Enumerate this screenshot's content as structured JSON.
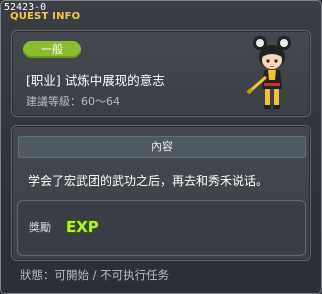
{
  "window": {
    "quest_id": "52423-0",
    "title": "QUEST INFO"
  },
  "quest": {
    "category": "一般",
    "name": "[职业] 试炼中展现的意志",
    "level_range": "建議等級：60～64",
    "npc_portrait": "martial-arts-girl-portrait"
  },
  "content": {
    "header": "內容",
    "description": "学会了宏武团的武功之后，再去和秀禾说话。"
  },
  "reward": {
    "label": "獎勵",
    "items": [
      "EXP"
    ]
  },
  "status": {
    "text": "狀態：可開始 / 不可执行任务"
  },
  "colors": {
    "title": "#f5c94a",
    "badge": "#8bbc2e",
    "exp_fill": "#b7ee2c",
    "exp_outline": "#2f6b0d"
  }
}
